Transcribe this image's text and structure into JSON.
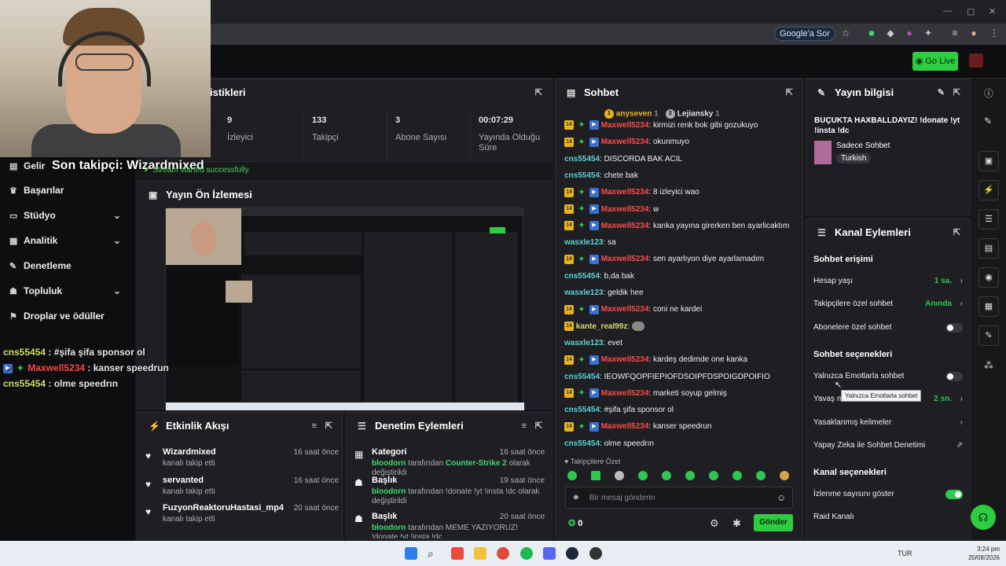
{
  "browser": {
    "ask_google": "Google'a Sor"
  },
  "header": {
    "go_live": "Go Live"
  },
  "sidebar": {
    "items": [
      {
        "label": "Gelir",
        "icon": "dollar-icon"
      },
      {
        "label": "Başarılar",
        "icon": "trophy-icon"
      },
      {
        "label": "Stüdyo",
        "icon": "studio-icon"
      },
      {
        "label": "Analitik",
        "icon": "chart-icon"
      },
      {
        "label": "Denetleme",
        "icon": "wrench-icon"
      },
      {
        "label": "Topluluk",
        "icon": "people-icon"
      },
      {
        "label": "Droplar ve ödüller",
        "icon": "gift-icon"
      }
    ]
  },
  "overlay": {
    "follower": "Son takipçi: Wizardmixed",
    "toast": "Stream started successfully.",
    "chat": [
      {
        "user": "cns55454",
        "text": " : #şifa şifa sponsor ol"
      },
      {
        "user": "Maxwell5234",
        "text": " : kanser speedrun"
      },
      {
        "user": "cns55454",
        "text": " : olme speedrın"
      }
    ]
  },
  "stats": {
    "title": "istikleri",
    "cells": [
      {
        "value": "9",
        "label": "İzleyici"
      },
      {
        "value": "133",
        "label": "Takipçi"
      },
      {
        "value": "3",
        "label": "Abone Sayısı"
      },
      {
        "value": "00:07:29",
        "label": "Yayında Olduğu Süre"
      }
    ]
  },
  "preview": {
    "title": "Yayın Ön İzlemesi"
  },
  "events": {
    "title": "Etkinlik Akışı",
    "items": [
      {
        "name": "Wizardmixed",
        "sub": "kanalı takip etti",
        "time": "16 saat önce"
      },
      {
        "name": "servanted",
        "sub": "kanalı takip etti",
        "time": "16 saat önce"
      },
      {
        "name": "FuzyonReaktoruHastasi_mp4",
        "sub": "kanalı takip etti",
        "time": "20 saat önce"
      }
    ]
  },
  "moderation": {
    "title": "Denetim Eylemleri",
    "items": [
      {
        "name": "Kategori",
        "by": "bloodorn",
        "mid": " tarafından ",
        "value": "Counter-Strike 2",
        "end": " olarak değiştirildi",
        "time": "16 saat önce"
      },
      {
        "name": "Başlık",
        "by": "bloodorn",
        "mid": " tarafından ",
        "value": "",
        "end": "!donate !yt !insta !dc olarak değiştirildi",
        "time": "19 saat önce"
      },
      {
        "name": "Başlık",
        "by": "bloodorn",
        "mid": " tarafından ",
        "value": "",
        "end": "MEME YAZIYORUZ! !donate !yt !insta !dc",
        "time": "20 saat önce"
      }
    ]
  },
  "chat": {
    "title": "Sohbet",
    "top_users": [
      {
        "rank": "1",
        "name": "anyseven",
        "count": "1"
      },
      {
        "rank": "2",
        "name": "Lejiansky",
        "count": "1"
      }
    ],
    "messages": [
      {
        "user": "Maxwell5234",
        "color": "red",
        "badges": true,
        "text": "kirmizi renk bok gibi gozukuyo"
      },
      {
        "user": "Maxwell5234",
        "color": "red",
        "badges": true,
        "text": "okunmuyo"
      },
      {
        "user": "cns55454",
        "color": "teal",
        "badges": false,
        "text": "DISCORDA BAK ACIL"
      },
      {
        "user": "cns55454",
        "color": "teal",
        "badges": false,
        "text": "chete bak"
      },
      {
        "user": "Maxwell5234",
        "color": "red",
        "badges": true,
        "text": "8 izleyici wao"
      },
      {
        "user": "Maxwell5234",
        "color": "red",
        "badges": true,
        "text": "w"
      },
      {
        "user": "Maxwell5234",
        "color": "red",
        "badges": true,
        "text": "kanka yayına girerken ben ayarlicaktım"
      },
      {
        "user": "wasxle123",
        "color": "teal",
        "badges": false,
        "text": "sa"
      },
      {
        "user": "Maxwell5234",
        "color": "red",
        "badges": true,
        "text": "sen ayarlıyon diye ayarlamadım"
      },
      {
        "user": "cns55454",
        "color": "teal",
        "badges": false,
        "text": "b,da bak"
      },
      {
        "user": "wasxle123",
        "color": "teal",
        "badges": false,
        "text": "geldik hee"
      },
      {
        "user": "Maxwell5234",
        "color": "red",
        "badges": true,
        "text": "coni ne kardei"
      },
      {
        "user": "kante_real99z",
        "color": "yellow",
        "badges": "sub",
        "text": ""
      },
      {
        "user": "wasxle123",
        "color": "teal",
        "badges": false,
        "text": "evet"
      },
      {
        "user": "Maxwell5234",
        "color": "red",
        "badges": true,
        "text": "kardeş dedimde one kanka"
      },
      {
        "user": "cns55454",
        "color": "teal",
        "badges": false,
        "text": "IEOWFQOPFIEPIOFDSOIPFDSPOIGDPOIFIO"
      },
      {
        "user": "Maxwell5234",
        "color": "red",
        "badges": true,
        "text": "marketi soyup gelmiş"
      },
      {
        "user": "cns55454",
        "color": "teal",
        "badges": false,
        "text": "#şifa şifa sponsor ol"
      },
      {
        "user": "Maxwell5234",
        "color": "red",
        "badges": true,
        "text": "kanser speedrun"
      },
      {
        "user": "cns55454",
        "color": "teal",
        "badges": false,
        "text": "olme speedrın"
      }
    ],
    "follower_only": "Takipçilere Özel",
    "input_placeholder": "Bir mesaj gönderin",
    "points": "0",
    "send": "Gönder"
  },
  "stream_info": {
    "title": "Yayın bilgisi",
    "stream_title": "BUÇUKTA HAXBALLDAYIZ! !donate !yt !insta !dc",
    "category": "Sadece Sohbet",
    "language": "Turkish"
  },
  "channel_actions": {
    "title": "Kanal Eylemleri",
    "chat_access": "Sohbet erişimi",
    "account_age": "Hesap yaşı",
    "account_age_value": "1 sa.",
    "follower_chat": "Takipçilere özel sohbet",
    "follower_chat_value": "Anında",
    "sub_chat": "Abonelere özel sohbet",
    "chat_options": "Sohbet seçenekleri",
    "emote_only": "Yalnızca Emotlarla sohbet",
    "tooltip": "Yalnızca Emotlarla sohbet",
    "slow": "Yavaş m",
    "slow_value": "2 sn.",
    "banned_words": "Yasaklanmış kelimeler",
    "ai_mod": "Yapay Zeka ile Sohbet Denetimi",
    "channel_options": "Kanal seçenekleri",
    "show_viewers": "İzlenme sayısını göster",
    "raid": "Raid Kanalı"
  },
  "taskbar": {
    "lang": "TUR",
    "time": "3:24 pm",
    "date": "20/08/2026"
  }
}
